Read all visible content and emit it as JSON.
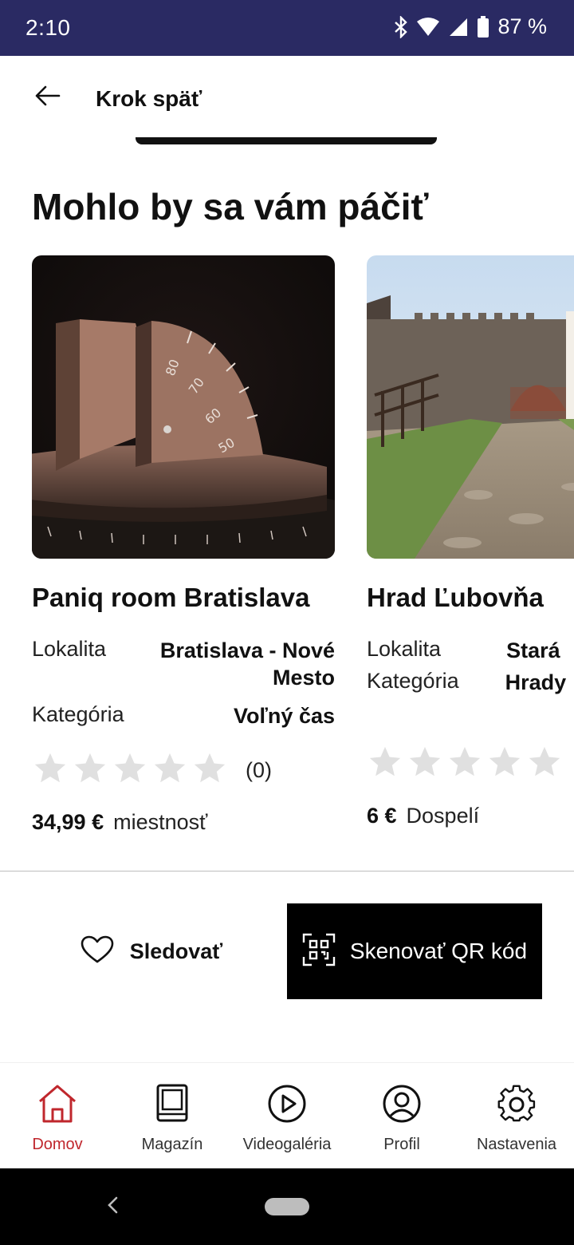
{
  "status": {
    "time": "2:10",
    "battery": "87 %"
  },
  "topbar": {
    "back_label": "Krok späť"
  },
  "section": {
    "title": "Mohlo by sa vám páčiť"
  },
  "cards": [
    {
      "title": "Paniq room Bratislava",
      "location_label": "Lokalita",
      "location_value": "Bratislava - Nové Mesto",
      "category_label": "Kategória",
      "category_value": "Voľný čas",
      "rating": 0,
      "rating_count": "(0)",
      "price": "34,99 €",
      "price_unit": "miestnosť"
    },
    {
      "title": "Hrad Ľubovňa",
      "location_label": "Lokalita",
      "location_value": "Stará",
      "category_label": "Kategória",
      "category_value": "Hrady",
      "rating": 0,
      "rating_count": "",
      "price": "6 €",
      "price_unit": "Dospelí"
    }
  ],
  "actions": {
    "follow_label": "Sledovať",
    "qr_label": "Skenovať QR kód"
  },
  "nav": {
    "items": [
      {
        "label": "Domov",
        "icon": "home-icon",
        "active": true
      },
      {
        "label": "Magazín",
        "icon": "book-icon",
        "active": false
      },
      {
        "label": "Videogaléria",
        "icon": "play-icon",
        "active": false
      },
      {
        "label": "Profil",
        "icon": "profile-icon",
        "active": false
      },
      {
        "label": "Nastavenia",
        "icon": "gear-icon",
        "active": false
      }
    ]
  },
  "colors": {
    "statusbar": "#2a2a63",
    "accent": "#c0272d",
    "star": "#e0e0e0",
    "qr_button": "#000000"
  }
}
